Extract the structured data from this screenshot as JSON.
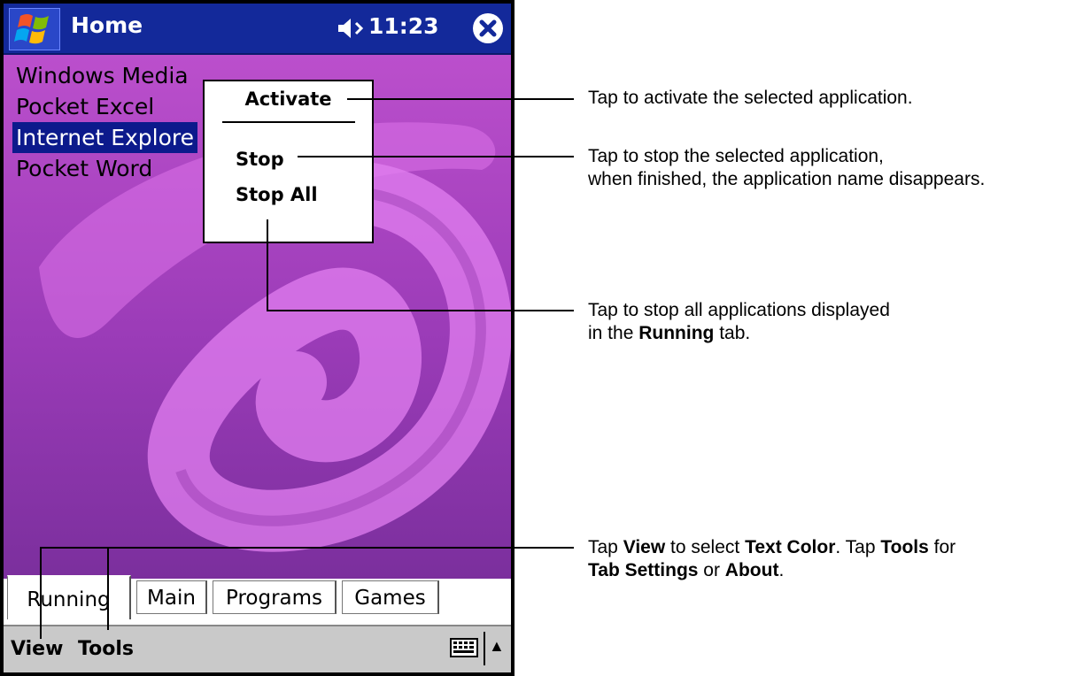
{
  "title_bar": {
    "title": "Home",
    "time": "11:23"
  },
  "running_apps": [
    "Windows Media",
    "Pocket Excel",
    "Internet Explore",
    "Pocket Word"
  ],
  "selected_app_index": 2,
  "context_menu": {
    "activate": "Activate",
    "stop": "Stop",
    "stop_all": "Stop All"
  },
  "tabs": [
    "Running",
    "Main",
    "Programs",
    "Games"
  ],
  "menu_bar": {
    "view": "View",
    "tools": "Tools"
  },
  "annotations": {
    "activate": "Tap to activate the selected application.",
    "stop_line1": "Tap to stop the selected application,",
    "stop_line2": "when finished, the application name disappears.",
    "stopall_line1": "Tap to stop all applications displayed",
    "stopall_pre": "in the ",
    "stopall_bold": "Running",
    "stopall_post": " tab.",
    "view_tap": "Tap ",
    "view_bold": "View",
    "view_mid": " to select ",
    "view_textcolor": "Text Color",
    "view_tap2": ". Tap ",
    "view_tools": "Tools",
    "view_for": " for",
    "view_tabsettings": "Tab Settings",
    "view_or": " or ",
    "view_about": "About",
    "view_end": "."
  },
  "colors": {
    "title_bar": "#13299a",
    "selection": "#0c1a8c",
    "desktop": "#a53fc0"
  },
  "icons": {
    "start": "windows-flag-icon",
    "volume": "speaker-icon",
    "close": "close-icon",
    "keyboard": "keyboard-icon",
    "sip": "up-arrow-icon"
  }
}
